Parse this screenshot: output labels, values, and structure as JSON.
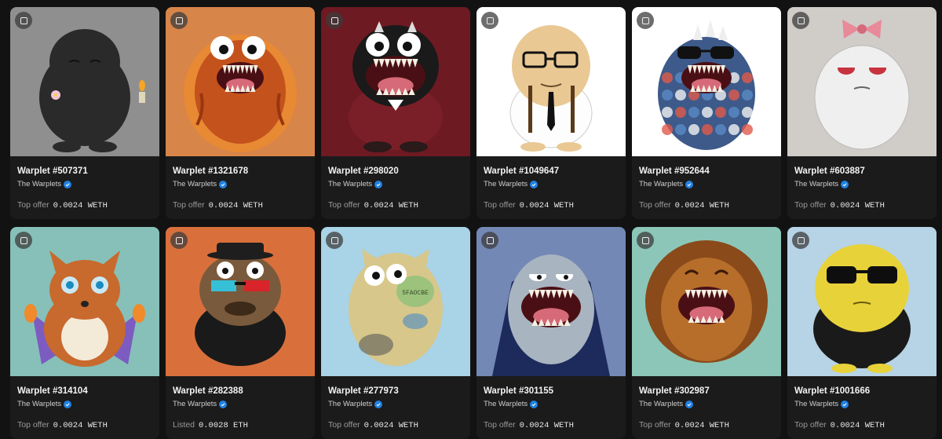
{
  "cards": [
    {
      "title": "Warplet #507371",
      "collection": "The Warplets",
      "price_label": "Top offer",
      "price": "0.0024 WETH",
      "bg": "#8f8f8f",
      "body": "#2a2a2a",
      "theme": "black-blob"
    },
    {
      "title": "Warplet #1321678",
      "collection": "The Warplets",
      "price_label": "Top offer",
      "price": "0.0024 WETH",
      "bg": "#d8854a",
      "body": "#c4521c",
      "theme": "fire-monster"
    },
    {
      "title": "Warplet #298020",
      "collection": "The Warplets",
      "price_label": "Top offer",
      "price": "0.0024 WETH",
      "bg": "#6e1a22",
      "body": "#1a1a1a",
      "theme": "black-sweater-monster"
    },
    {
      "title": "Warplet #1049647",
      "collection": "The Warplets",
      "price_label": "Top offer",
      "price": "0.0024 WETH",
      "bg": "#ffffff",
      "body": "#e9c893",
      "theme": "glasses-man"
    },
    {
      "title": "Warplet #952644",
      "collection": "The Warplets",
      "price_label": "Top offer",
      "price": "0.0024 WETH",
      "bg": "#ffffff",
      "body": "#3d5a8a",
      "theme": "scale-monster"
    },
    {
      "title": "Warplet #603887",
      "collection": "The Warplets",
      "price_label": "Top offer",
      "price": "0.0024 WETH",
      "bg": "#d0ccc8",
      "body": "#efefef",
      "theme": "bow-blob"
    },
    {
      "title": "Warplet #314104",
      "collection": "The Warplets",
      "price_label": "Top offer",
      "price": "0.0024 WETH",
      "bg": "#86c0b8",
      "body": "#c8692e",
      "theme": "fox"
    },
    {
      "title": "Warplet #282388",
      "collection": "The Warplets",
      "price_label": "Listed",
      "price": "0.0028 ETH",
      "bg": "#d9703c",
      "body": "#7a5a3c",
      "theme": "sloth"
    },
    {
      "title": "Warplet #277973",
      "collection": "The Warplets",
      "price_label": "Top offer",
      "price": "0.0024 WETH",
      "bg": "#a9d3e6",
      "body": "#d7c78a",
      "theme": "cat",
      "badge_text": "5FAOCBE"
    },
    {
      "title": "Warplet #301155",
      "collection": "The Warplets",
      "price_label": "Top offer",
      "price": "0.0024 WETH",
      "bg": "#7488b6",
      "body": "#a8b4c0",
      "theme": "cloak-monster"
    },
    {
      "title": "Warplet #302987",
      "collection": "The Warplets",
      "price_label": "Top offer",
      "price": "0.0024 WETH",
      "bg": "#8cc6b8",
      "body": "#b76e2a",
      "theme": "lion"
    },
    {
      "title": "Warplet #1001666",
      "collection": "The Warplets",
      "price_label": "Top offer",
      "price": "0.0024 WETH",
      "bg": "#b7d3e6",
      "body": "#e8d23a",
      "theme": "yellow-blob-sunglasses"
    }
  ]
}
